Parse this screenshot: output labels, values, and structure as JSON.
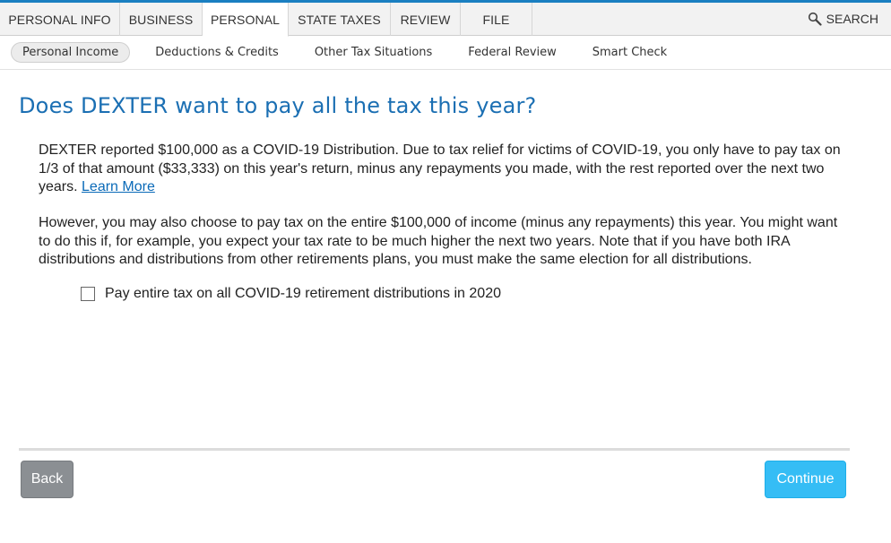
{
  "top_tabs": [
    {
      "label": "PERSONAL INFO"
    },
    {
      "label": "BUSINESS"
    },
    {
      "label": "PERSONAL"
    },
    {
      "label": "STATE TAXES"
    },
    {
      "label": "REVIEW"
    },
    {
      "label": "FILE"
    }
  ],
  "active_tab": "PERSONAL",
  "search": {
    "label": "SEARCH",
    "icon": "magnifier-icon"
  },
  "subnav": [
    {
      "label": "Personal Income"
    },
    {
      "label": "Deductions & Credits"
    },
    {
      "label": "Other Tax Situations"
    },
    {
      "label": "Federal Review"
    },
    {
      "label": "Smart Check"
    }
  ],
  "main": {
    "title": "Does DEXTER want to pay all the tax this year?",
    "para1_text": "DEXTER reported $100,000 as a COVID-19 Distribution. Due to tax relief for victims of COVID-19, you only have to pay tax on 1/3 of that amount ($33,333) on this year's return, minus any repayments you made, with the rest reported over the next two years. ",
    "para1_link": "Learn More",
    "para2_text": "However, you may also choose to pay tax on the entire $100,000 of income (minus any repayments) this year. You might want to do this if, for example, you expect your tax rate to be much higher the next two years. Note that if you have both IRA distributions and distributions from other retirements plans, you must make the same election for all distributions.",
    "checkbox_label": "Pay entire tax on all COVID-19 retirement distributions in 2020",
    "checkbox_checked": false
  },
  "buttons": {
    "back": "Back",
    "continue": "Continue"
  },
  "colors": {
    "accent": "#1b6fb3",
    "link": "#0a6ab8",
    "continue_button": "#35bdf5",
    "back_button": "#8b8f93",
    "top_border": "#1a7fc1"
  }
}
